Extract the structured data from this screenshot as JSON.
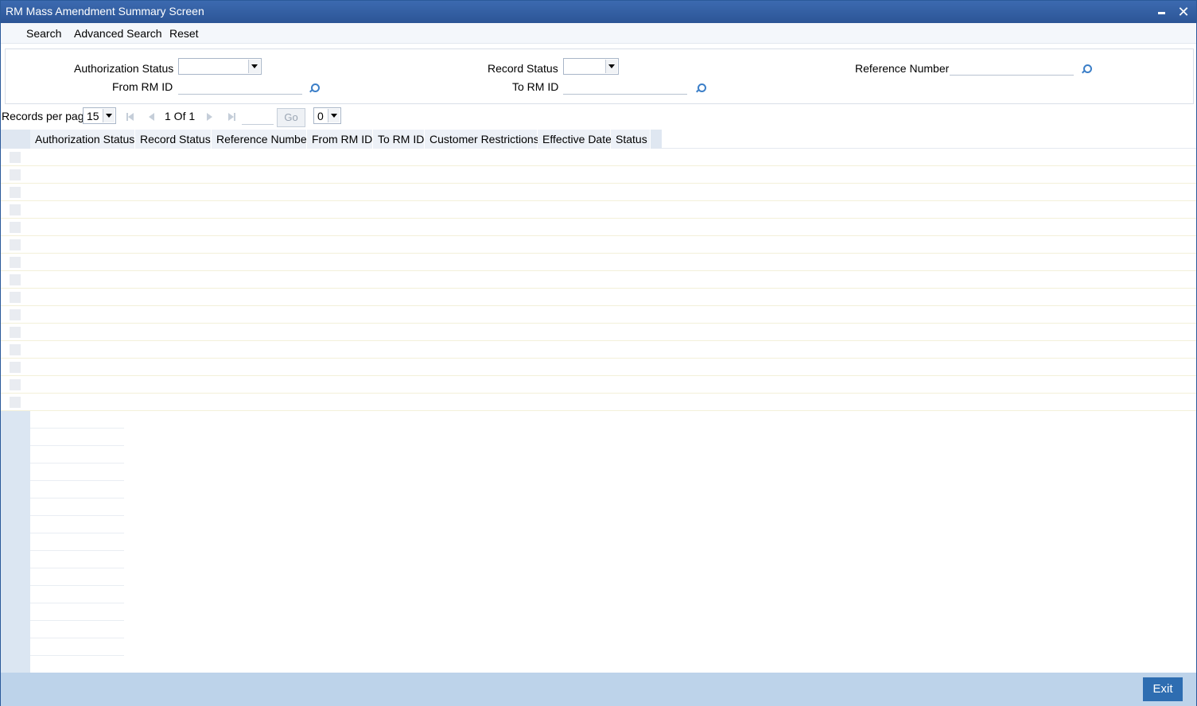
{
  "window": {
    "title": "RM Mass Amendment Summary Screen"
  },
  "menu": {
    "search": "Search",
    "advanced_search": "Advanced Search",
    "reset": "Reset"
  },
  "criteria": {
    "authorization_status_label": "Authorization Status",
    "authorization_status_value": "",
    "record_status_label": "Record Status",
    "record_status_value": "",
    "reference_number_label": "Reference Number",
    "reference_number_value": "",
    "from_rm_id_label": "From RM ID",
    "from_rm_id_value": "",
    "to_rm_id_label": "To RM ID",
    "to_rm_id_value": ""
  },
  "pager": {
    "records_per_page_label": "Records per page",
    "records_per_page_value": "15",
    "page_info": "1 Of 1",
    "go_label": "Go",
    "page_select_value": "0"
  },
  "grid": {
    "columns": [
      "Authorization Status",
      "Record Status",
      "Reference Number",
      "From RM ID",
      "To RM ID",
      "Customer Restrictions",
      "Effective Date",
      "Status"
    ],
    "rows": []
  },
  "footer": {
    "exit_label": "Exit"
  },
  "colors": {
    "titlebar": "#2c5596",
    "footer": "#bdd3ea",
    "exit_button": "#2e6db1"
  }
}
